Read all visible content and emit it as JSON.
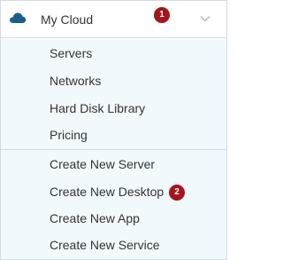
{
  "header": {
    "label": "My Cloud",
    "icon": "cloud-icon",
    "chevron": "chevron-down-icon",
    "badge": "1"
  },
  "menu": {
    "group1": [
      {
        "label": "Servers"
      },
      {
        "label": "Networks"
      },
      {
        "label": "Hard Disk Library"
      },
      {
        "label": "Pricing"
      }
    ],
    "group2": [
      {
        "label": "Create New Server"
      },
      {
        "label": "Create New Desktop"
      },
      {
        "label": "Create New App"
      },
      {
        "label": "Create New Service"
      }
    ]
  },
  "annotation": {
    "badge2": "2"
  },
  "colors": {
    "badge": "#a5151b",
    "menu_background": "#f2f9fc",
    "cloud_icon": "#1a5f8a",
    "border": "#cfdce3",
    "text": "#333333"
  }
}
